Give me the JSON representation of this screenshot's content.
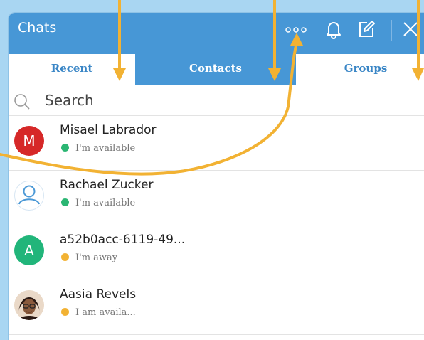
{
  "window": {
    "title": "Chats"
  },
  "header_icons": [
    "more-options-icon",
    "bell-icon",
    "compose-icon",
    "close-icon"
  ],
  "tabs": [
    {
      "label": "Recent",
      "active": true
    },
    {
      "label": "Contacts",
      "active": false
    },
    {
      "label": "Groups",
      "active": false
    }
  ],
  "search": {
    "placeholder": "Search"
  },
  "contacts": [
    {
      "name": "Misael Labrador",
      "status": "I'm available",
      "status_color": "#2bb673",
      "avatar": {
        "type": "initial",
        "text": "M",
        "color": "#d62828"
      }
    },
    {
      "name": "Rachael Zucker",
      "status": "I'm available",
      "status_color": "#2bb673",
      "avatar": {
        "type": "icon",
        "icon": "user-outline-icon",
        "color": "#4a98d6"
      }
    },
    {
      "name": "a52b0acc-6119-49...",
      "status": "I'm away",
      "status_color": "#f2b233",
      "avatar": {
        "type": "initial",
        "text": "A",
        "color": "#21b57a"
      }
    },
    {
      "name": "Aasia Revels",
      "status": "I am availa...",
      "status_color": "#f2b233",
      "avatar": {
        "type": "photo",
        "icon": "person-photo-icon"
      }
    }
  ],
  "colors": {
    "header": "#4797d6",
    "background": "#a9d6f2",
    "annotation": "#f2b233"
  }
}
